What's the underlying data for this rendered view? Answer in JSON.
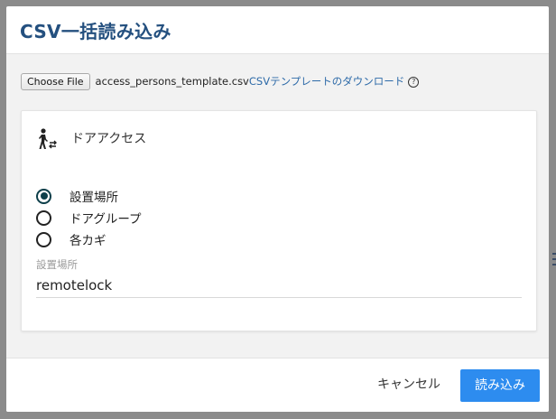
{
  "dialog": {
    "title": "CSV一括読み込み"
  },
  "file_input": {
    "button_label": "Choose File",
    "file_name": "access_persons_template.csv",
    "template_link": "CSVテンプレートのダウンロード",
    "help_glyph": "?"
  },
  "section": {
    "title": "ドアアクセス",
    "icon": "person-door-icon"
  },
  "radio_options": [
    {
      "label": "設置場所",
      "checked": true
    },
    {
      "label": "ドアグループ",
      "checked": false
    },
    {
      "label": "各カギ",
      "checked": false
    }
  ],
  "location_field": {
    "label": "設置場所",
    "value": "remotelock"
  },
  "footer": {
    "cancel_label": "キャンセル",
    "import_label": "読み込み"
  },
  "colors": {
    "title": "#24507f",
    "link": "#2d6aa8",
    "primary_button": "#2d8cef",
    "radio_checked": "#0d3f4a"
  }
}
